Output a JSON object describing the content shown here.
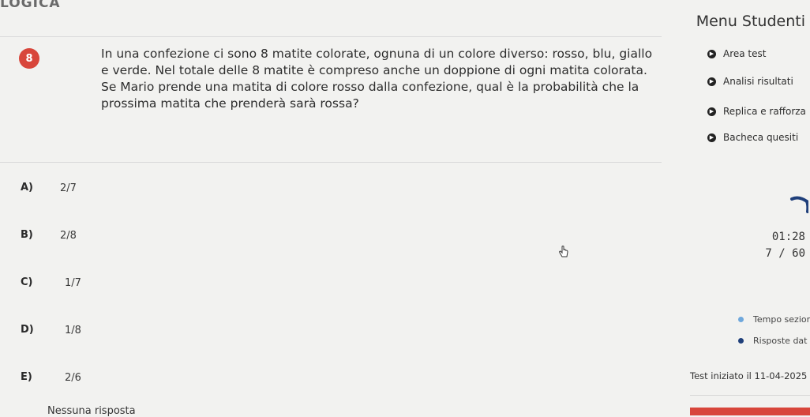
{
  "header": {
    "logo": "LOGICA",
    "menu_title": "Menu Studenti"
  },
  "question": {
    "number": "8",
    "text": "In una confezione ci sono 8 matite colorate, ognuna di un colore diverso: rosso, blu, giallo e verde. Nel totale delle 8 matite è compreso anche un doppione di ogni matita colorata. Se Mario prende una matita di colore rosso dalla confezione, qual è la probabilità che la prossima matita che prenderà sarà rossa?"
  },
  "answers": [
    {
      "letter": "A)",
      "value": "2/7"
    },
    {
      "letter": "B)",
      "value": "2/8"
    },
    {
      "letter": "C)",
      "value": "1/7"
    },
    {
      "letter": "D)",
      "value": "1/8"
    },
    {
      "letter": "E)",
      "value": "2/6"
    }
  ],
  "no_answer_label": "Nessuna risposta",
  "menu": {
    "items": [
      {
        "label": "Area test",
        "icon": "chevron-right-icon"
      },
      {
        "label": "Analisi risultati",
        "icon": "chevron-right-icon"
      },
      {
        "label": "Replica e rafforza",
        "icon": "chevron-right-icon"
      },
      {
        "label": "Bacheca quesiti",
        "icon": "chevron-right-icon"
      }
    ]
  },
  "status": {
    "timer": "01:28",
    "counter": "7 / 60"
  },
  "legend": [
    {
      "label": "Tempo sezior",
      "color": "#6fa8dc"
    },
    {
      "label": "Risposte dat",
      "color": "#1f3f7a"
    }
  ],
  "test_started": "Test iniziato il 11-04-2025 al",
  "colors": {
    "accent_red": "#d8463b",
    "background": "#f2f2f0"
  }
}
